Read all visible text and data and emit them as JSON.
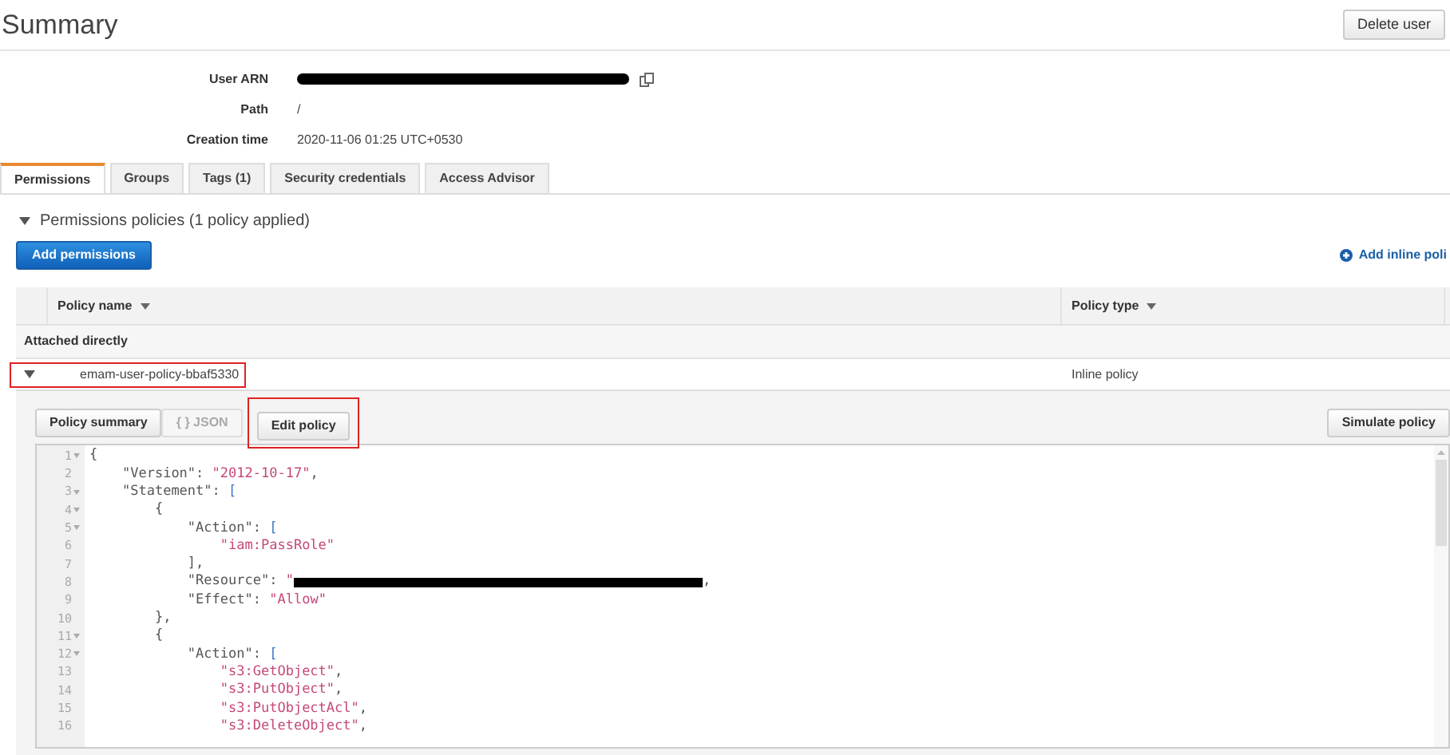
{
  "header": {
    "title": "Summary",
    "delete_button": "Delete user"
  },
  "details": [
    {
      "label": "User ARN",
      "kind": "redacted"
    },
    {
      "label": "Path",
      "kind": "text",
      "value": "/"
    },
    {
      "label": "Creation time",
      "kind": "text",
      "value": "2020-11-06 01:25 UTC+0530"
    }
  ],
  "tabs": [
    {
      "label": "Permissions",
      "selected": true
    },
    {
      "label": "Groups",
      "selected": false
    },
    {
      "label": "Tags (1)",
      "selected": false
    },
    {
      "label": "Security credentials",
      "selected": false
    },
    {
      "label": "Access Advisor",
      "selected": false
    }
  ],
  "section": {
    "title": "Permissions policies (1 policy applied)",
    "expanded": true,
    "add_button": "Add permissions",
    "inline_link": "Add inline poli"
  },
  "table": {
    "columns": [
      "Policy name",
      "Policy type"
    ],
    "group": "Attached directly",
    "rows": [
      {
        "name": "emam-user-policy-bbaf5330",
        "type": "Inline policy",
        "expanded": true,
        "highlighted": true
      }
    ]
  },
  "policy_view": {
    "buttons": [
      {
        "label": "Policy summary",
        "kind": "tab",
        "disabled": false,
        "highlighted": false
      },
      {
        "label": "{ } JSON",
        "kind": "tab",
        "disabled": true,
        "highlighted": false
      },
      {
        "label": "Edit policy",
        "kind": "action",
        "disabled": false,
        "highlighted": true
      }
    ],
    "simulate_button": "Simulate policy",
    "code_lines": [
      {
        "number": "1",
        "fold": true,
        "tokens": [
          {
            "kind": "punct",
            "text": "{"
          }
        ]
      },
      {
        "number": "2",
        "fold": false,
        "tokens": [
          {
            "kind": "key",
            "text": "    \"Version\": "
          },
          {
            "kind": "string",
            "text": "\"2012-10-17\""
          },
          {
            "kind": "punct",
            "text": ","
          }
        ]
      },
      {
        "number": "3",
        "fold": true,
        "tokens": [
          {
            "kind": "key",
            "text": "    \"Statement\": "
          },
          {
            "kind": "bracket",
            "text": "["
          }
        ]
      },
      {
        "number": "4",
        "fold": true,
        "tokens": [
          {
            "kind": "punct",
            "text": "        {"
          }
        ]
      },
      {
        "number": "5",
        "fold": true,
        "tokens": [
          {
            "kind": "key",
            "text": "            \"Action\": "
          },
          {
            "kind": "bracket",
            "text": "["
          }
        ]
      },
      {
        "number": "6",
        "fold": false,
        "tokens": [
          {
            "kind": "string",
            "text": "                \"iam:PassRole\""
          }
        ]
      },
      {
        "number": "7",
        "fold": false,
        "tokens": [
          {
            "kind": "punct",
            "text": "            ],"
          }
        ]
      },
      {
        "number": "8",
        "fold": false,
        "tokens": [
          {
            "kind": "key",
            "text": "            \"Resource\": "
          },
          {
            "kind": "string",
            "text": "\""
          },
          {
            "kind": "redacted"
          },
          {
            "kind": "punct",
            "text": ","
          }
        ]
      },
      {
        "number": "9",
        "fold": false,
        "tokens": [
          {
            "kind": "key",
            "text": "            \"Effect\": "
          },
          {
            "kind": "string",
            "text": "\"Allow\""
          }
        ]
      },
      {
        "number": "10",
        "fold": false,
        "tokens": [
          {
            "kind": "punct",
            "text": "        },"
          }
        ]
      },
      {
        "number": "11",
        "fold": true,
        "tokens": [
          {
            "kind": "punct",
            "text": "        {"
          }
        ]
      },
      {
        "number": "12",
        "fold": true,
        "tokens": [
          {
            "kind": "key",
            "text": "            \"Action\": "
          },
          {
            "kind": "bracket",
            "text": "["
          }
        ]
      },
      {
        "number": "13",
        "fold": false,
        "tokens": [
          {
            "kind": "string",
            "text": "                \"s3:GetObject\""
          },
          {
            "kind": "punct",
            "text": ","
          }
        ]
      },
      {
        "number": "14",
        "fold": false,
        "tokens": [
          {
            "kind": "string",
            "text": "                \"s3:PutObject\""
          },
          {
            "kind": "punct",
            "text": ","
          }
        ]
      },
      {
        "number": "15",
        "fold": false,
        "tokens": [
          {
            "kind": "string",
            "text": "                \"s3:PutObjectAcl\""
          },
          {
            "kind": "punct",
            "text": ","
          }
        ]
      },
      {
        "number": "16",
        "fold": false,
        "tokens": [
          {
            "kind": "string",
            "text": "                \"s3:DeleteObject\""
          },
          {
            "kind": "punct",
            "text": ","
          }
        ]
      }
    ]
  }
}
